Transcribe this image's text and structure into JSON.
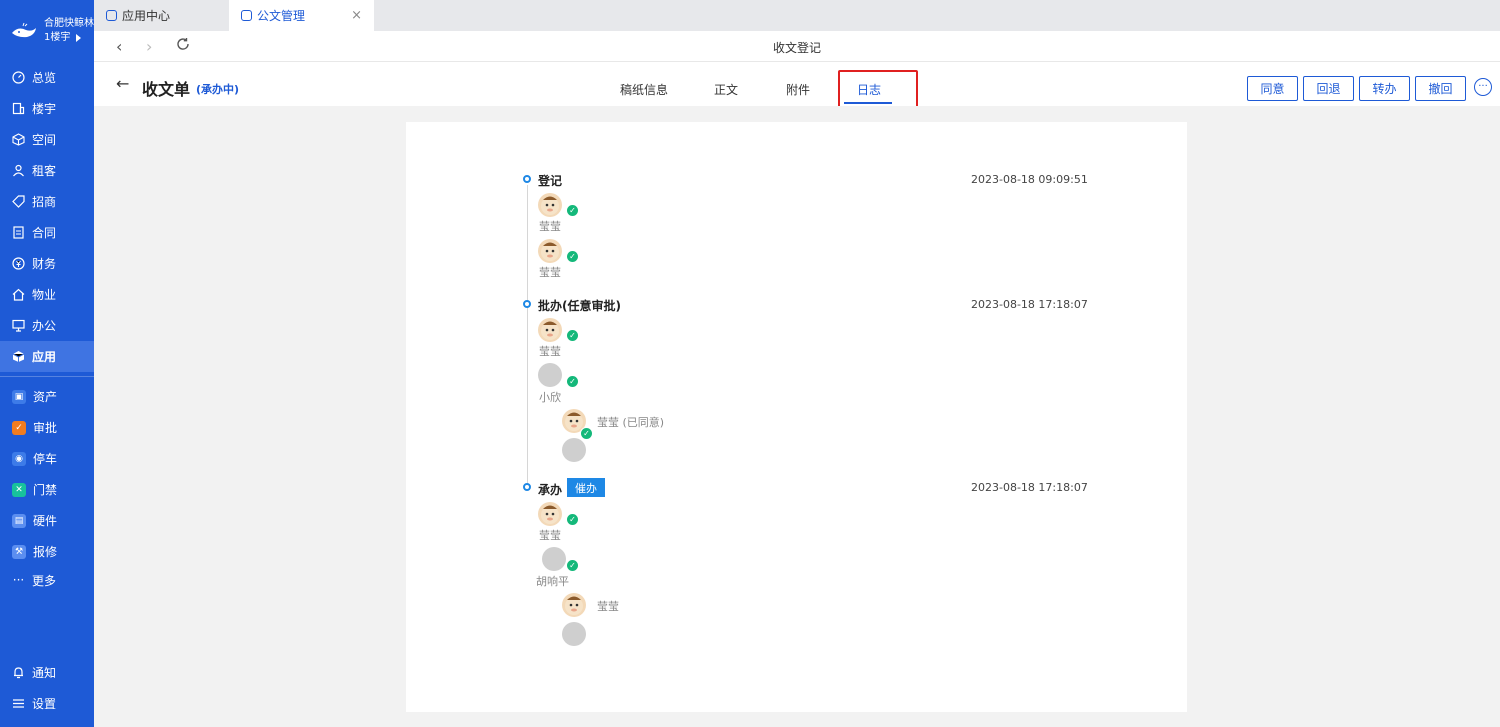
{
  "brand": {
    "name": "合肥快鲸林",
    "building": "1楼宇"
  },
  "sidebar": {
    "nav": [
      {
        "label": "总览",
        "icon": "dashboard-icon"
      },
      {
        "label": "楼宇",
        "icon": "building-icon"
      },
      {
        "label": "空间",
        "icon": "cube-icon"
      },
      {
        "label": "租客",
        "icon": "users-icon"
      },
      {
        "label": "招商",
        "icon": "tag-icon"
      },
      {
        "label": "合同",
        "icon": "document-icon"
      },
      {
        "label": "财务",
        "icon": "money-icon"
      },
      {
        "label": "物业",
        "icon": "home-icon"
      },
      {
        "label": "办公",
        "icon": "monitor-icon"
      },
      {
        "label": "应用",
        "icon": "app-icon"
      }
    ],
    "apps": [
      {
        "label": "资产",
        "color": "#3d7be8"
      },
      {
        "label": "审批",
        "color": "#f07c20"
      },
      {
        "label": "停车",
        "color": "#3d7be8"
      },
      {
        "label": "门禁",
        "color": "#18c29c"
      },
      {
        "label": "硬件",
        "color": "#5b8ef0"
      },
      {
        "label": "报修",
        "color": "#5b8ef0"
      }
    ],
    "more": "更多",
    "notify": "通知",
    "settings": "设置"
  },
  "tabs": [
    {
      "label": "应用中心"
    },
    {
      "label": "公文管理",
      "close": "×"
    }
  ],
  "addr": {
    "title": "收文登记"
  },
  "header": {
    "back": "←",
    "title": "收文单",
    "status": "(承办中)",
    "tabs": [
      "稿纸信息",
      "正文",
      "附件",
      "日志"
    ],
    "actions": [
      "同意",
      "回退",
      "转办",
      "撤回"
    ],
    "more": "···"
  },
  "log": {
    "steps": [
      {
        "title": "登记",
        "time": "2023-08-18 09:09:51"
      },
      {
        "title": "批办(任意审批)",
        "time": "2023-08-18 17:18:07"
      },
      {
        "title": "承办",
        "time": "2023-08-18 17:18:07",
        "badge": "催办"
      }
    ],
    "users": {
      "u1": "莹莹",
      "u2": "莹莹",
      "u3": "莹莹",
      "u4": "小欣",
      "u4sub": "莹莹 (已同意)",
      "u5": "莹莹",
      "u6": "胡响平",
      "u6sub": "莹莹"
    }
  }
}
